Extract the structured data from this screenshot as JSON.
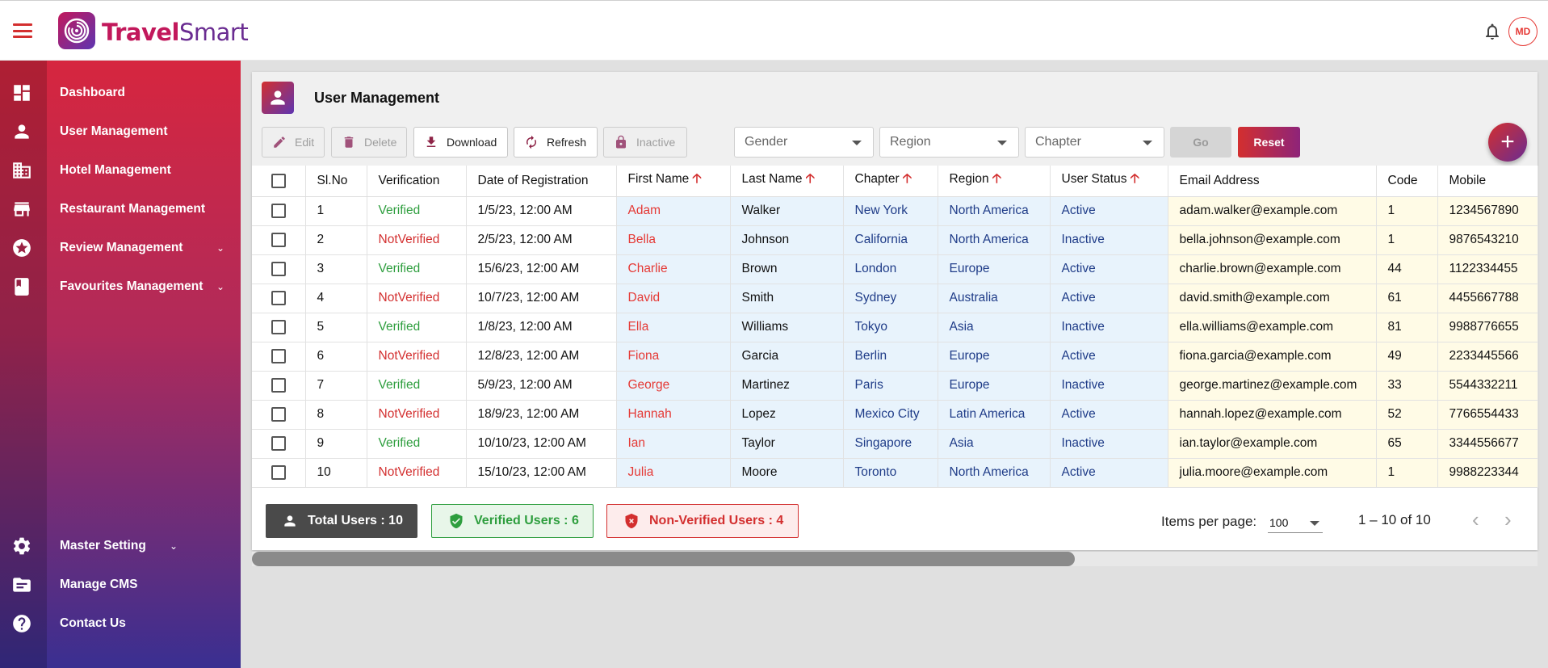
{
  "brand": {
    "name_part1": "Travel",
    "name_part2": "Smart"
  },
  "header": {
    "avatar_initials": "MD"
  },
  "sidebar": {
    "items": [
      {
        "label": "Dashboard",
        "icon": "dashboard-icon"
      },
      {
        "label": "User Management",
        "icon": "person-icon"
      },
      {
        "label": "Hotel Management",
        "icon": "building-icon"
      },
      {
        "label": "Restaurant Management",
        "icon": "store-icon"
      },
      {
        "label": "Review Management",
        "icon": "star-icon",
        "expandable": true
      },
      {
        "label": "Favourites Management",
        "icon": "book-icon",
        "expandable": true
      }
    ],
    "bottom_items": [
      {
        "label": "Master Setting",
        "icon": "gear-icon",
        "expandable": true
      },
      {
        "label": "Manage CMS",
        "icon": "folder-icon"
      },
      {
        "label": "Contact Us",
        "icon": "help-icon"
      }
    ]
  },
  "page": {
    "title": "User Management"
  },
  "toolbar": {
    "edit": "Edit",
    "delete": "Delete",
    "download": "Download",
    "refresh": "Refresh",
    "inactive": "Inactive"
  },
  "filters": {
    "gender": "Gender",
    "region": "Region",
    "chapter": "Chapter",
    "go": "Go",
    "reset": "Reset"
  },
  "table": {
    "columns": [
      "Sl.No",
      "Verification",
      "Date of Registration",
      "First Name",
      "Last Name",
      "Chapter",
      "Region",
      "User Status",
      "Email Address",
      "Code",
      "Mobile"
    ],
    "rows": [
      [
        "1",
        "Verified",
        "1/5/23, 12:00 AM",
        "Adam",
        "Walker",
        "New York",
        "North America",
        "Active",
        "adam.walker@example.com",
        "1",
        "1234567890"
      ],
      [
        "2",
        "NotVerified",
        "2/5/23, 12:00 AM",
        "Bella",
        "Johnson",
        "California",
        "North America",
        "Inactive",
        "bella.johnson@example.com",
        "1",
        "9876543210"
      ],
      [
        "3",
        "Verified",
        "15/6/23, 12:00 AM",
        "Charlie",
        "Brown",
        "London",
        "Europe",
        "Active",
        "charlie.brown@example.com",
        "44",
        "1122334455"
      ],
      [
        "4",
        "NotVerified",
        "10/7/23, 12:00 AM",
        "David",
        "Smith",
        "Sydney",
        "Australia",
        "Active",
        "david.smith@example.com",
        "61",
        "4455667788"
      ],
      [
        "5",
        "Verified",
        "1/8/23, 12:00 AM",
        "Ella",
        "Williams",
        "Tokyo",
        "Asia",
        "Inactive",
        "ella.williams@example.com",
        "81",
        "9988776655"
      ],
      [
        "6",
        "NotVerified",
        "12/8/23, 12:00 AM",
        "Fiona",
        "Garcia",
        "Berlin",
        "Europe",
        "Active",
        "fiona.garcia@example.com",
        "49",
        "2233445566"
      ],
      [
        "7",
        "Verified",
        "5/9/23, 12:00 AM",
        "George",
        "Martinez",
        "Paris",
        "Europe",
        "Inactive",
        "george.martinez@example.com",
        "33",
        "5544332211"
      ],
      [
        "8",
        "NotVerified",
        "18/9/23, 12:00 AM",
        "Hannah",
        "Lopez",
        "Mexico City",
        "Latin America",
        "Active",
        "hannah.lopez@example.com",
        "52",
        "7766554433"
      ],
      [
        "9",
        "Verified",
        "10/10/23, 12:00 AM",
        "Ian",
        "Taylor",
        "Singapore",
        "Asia",
        "Inactive",
        "ian.taylor@example.com",
        "65",
        "3344556677"
      ],
      [
        "10",
        "NotVerified",
        "15/10/23, 12:00 AM",
        "Julia",
        "Moore",
        "Toronto",
        "North America",
        "Active",
        "julia.moore@example.com",
        "1",
        "9988223344"
      ]
    ]
  },
  "summary": {
    "total": "Total Users : 10",
    "verified": "Verified Users : 6",
    "non_verified": "Non-Verified Users : 4"
  },
  "pagination": {
    "items_per_page_label": "Items per page:",
    "items_per_page_value": "100",
    "range": "1 – 10 of 10"
  },
  "scroll": {
    "horizontal_position_fraction": 0.64
  },
  "colors": {
    "accent_red": "#d32f2f",
    "accent_purple": "#5e35b1",
    "verified_green": "#2e9e3e"
  }
}
